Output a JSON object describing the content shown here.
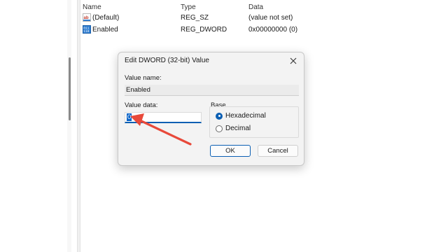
{
  "list": {
    "headers": {
      "name": "Name",
      "type": "Type",
      "data": "Data"
    },
    "rows": [
      {
        "name": "(Default)",
        "type": "REG_SZ",
        "data": "(value not set)",
        "icon": "string-value-icon"
      },
      {
        "name": "Enabled",
        "type": "REG_DWORD",
        "data": "0x00000000 (0)",
        "icon": "binary-value-icon"
      }
    ]
  },
  "dialog": {
    "title": "Edit DWORD (32-bit) Value",
    "value_name_label": "Value name:",
    "value_name": "Enabled",
    "value_data_label": "Value data:",
    "value_data": "0",
    "base_label": "Base",
    "base_options": [
      {
        "label": "Hexadecimal",
        "selected": true
      },
      {
        "label": "Decimal",
        "selected": false
      }
    ],
    "ok_label": "OK",
    "cancel_label": "Cancel"
  },
  "colors": {
    "accent": "#0b5fb3",
    "arrow": "#e8493a"
  }
}
